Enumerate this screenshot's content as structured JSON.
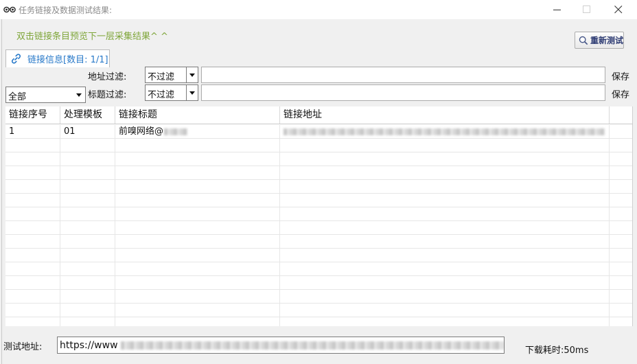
{
  "window": {
    "title": "任务链接及数据测试结果:",
    "app_icon": "binoculars-icon",
    "controls": [
      "minimize-icon",
      "maximize-icon",
      "close-icon"
    ]
  },
  "hint": {
    "text": "双击链接条目预览下一层采集结果^ ^"
  },
  "retest_button": {
    "label": "重新测试",
    "icon": "search-icon"
  },
  "tab": {
    "label": "链接信息[数目: 1/1]",
    "icon": "link-icon"
  },
  "filters": {
    "scope": {
      "selected": "全部"
    },
    "address": {
      "label": "地址过滤:",
      "mode": "不过滤",
      "value": "",
      "save_label": "保存"
    },
    "title": {
      "label": "标题过滤:",
      "mode": "不过滤",
      "value": "",
      "save_label": "保存"
    }
  },
  "table": {
    "columns": [
      "链接序号",
      "处理模板",
      "链接标题",
      "链接地址"
    ],
    "rows": [
      {
        "index": "1",
        "template": "01",
        "title": "前嗅网络@",
        "title_redacted": true,
        "url_redacted": true
      }
    ]
  },
  "footer": {
    "test_url_label": "测试地址:",
    "test_url_value": "https://www",
    "test_url_redacted": true,
    "download_time": "下载耗时:50ms"
  },
  "colors": {
    "hint": "#7fa63a",
    "tab_text": "#2879c9",
    "button_text": "#2c3a72",
    "title_text": "#8a8a8a",
    "window_bg": "#f0f0f0"
  }
}
